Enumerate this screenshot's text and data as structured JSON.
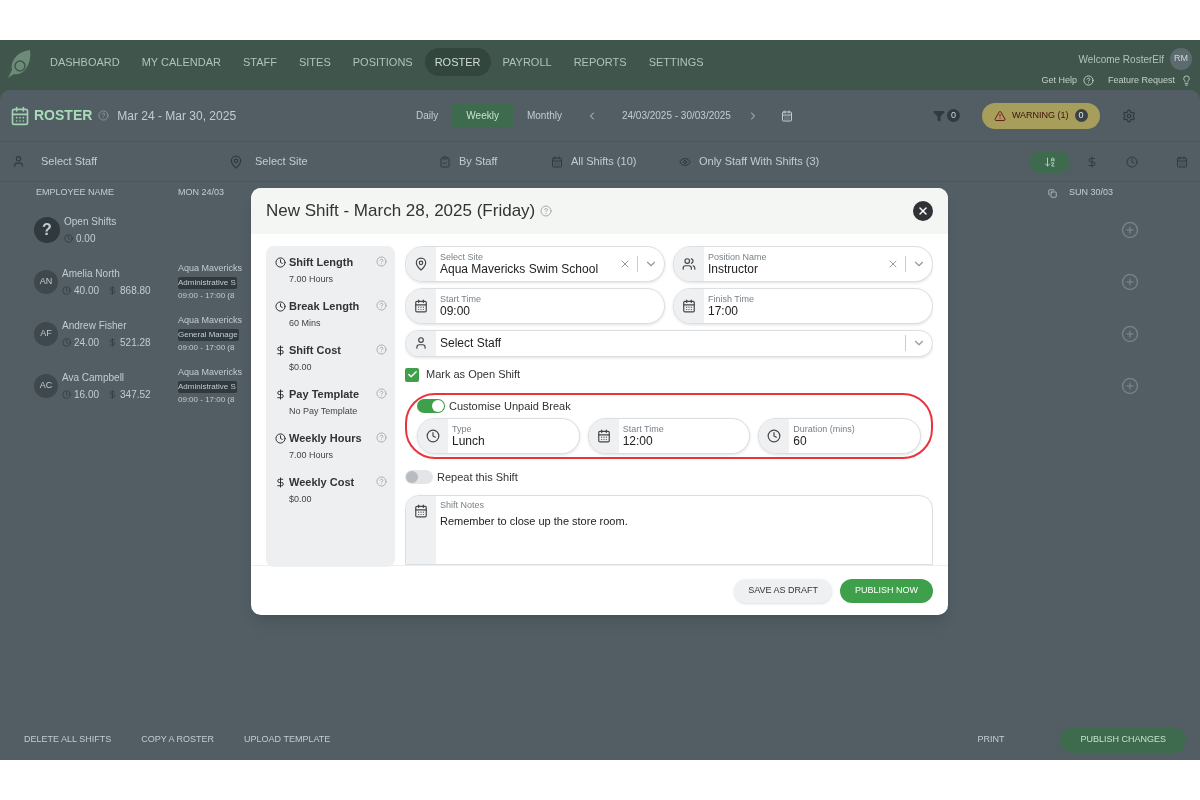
{
  "nav": {
    "items": [
      {
        "label": "DASHBOARD",
        "selected": false
      },
      {
        "label": "MY CALENDAR",
        "selected": false
      },
      {
        "label": "STAFF",
        "selected": false
      },
      {
        "label": "SITES",
        "selected": false
      },
      {
        "label": "POSITIONS",
        "selected": false
      },
      {
        "label": "ROSTER",
        "selected": true
      },
      {
        "label": "PAYROLL",
        "selected": false
      },
      {
        "label": "REPORTS",
        "selected": false
      },
      {
        "label": "SETTINGS",
        "selected": false
      }
    ],
    "welcome": "Welcome RosterElf",
    "avatar": "RM",
    "help": "Get Help",
    "feature": "Feature Request"
  },
  "toolbar": {
    "title": "ROSTER",
    "range": "Mar 24 - Mar 30, 2025",
    "views": [
      {
        "label": "Daily",
        "selected": false
      },
      {
        "label": "Weekly",
        "selected": true
      },
      {
        "label": "Monthly",
        "selected": false
      }
    ],
    "dates": "24/03/2025 - 30/03/2025",
    "filter_count": "0",
    "warning": "WARNING (1)",
    "warning_count": "0"
  },
  "filters": {
    "staff_placeholder": "Select Staff",
    "site_placeholder": "Select Site",
    "group": "By Staff",
    "shifts": "All Shifts (10)",
    "show": "Only Staff With Shifts (3)"
  },
  "roster": {
    "columns": [
      "EMPLOYEE NAME",
      "MON 24/03",
      "SUN 30/03"
    ],
    "rows": [
      {
        "kind": "open",
        "mark": "?",
        "name": "Open Shifts",
        "hours": "0.00"
      },
      {
        "kind": "staff",
        "initials": "AN",
        "name": "Amelia North",
        "hours": "40.00",
        "cost": "868.80",
        "shift": {
          "site": "Aqua Mavericks",
          "position": "Administrative S",
          "time": "09:00 - 17:00 (8"
        }
      },
      {
        "kind": "staff",
        "initials": "AF",
        "name": "Andrew Fisher",
        "hours": "24.00",
        "cost": "521.28",
        "shift": {
          "site": "Aqua Mavericks",
          "position": "General Manage",
          "time": "09:00 - 17:00 (8"
        }
      },
      {
        "kind": "staff",
        "initials": "AC",
        "name": "Ava Campbell",
        "hours": "16.00",
        "cost": "347.52",
        "shift": {
          "site": "Aqua Mavericks",
          "position": "Administrative S",
          "time": "09:00 - 17:00 (8"
        }
      }
    ]
  },
  "footer": {
    "left": [
      "DELETE ALL SHIFTS",
      "COPY A ROSTER",
      "UPLOAD TEMPLATE"
    ],
    "print": "PRINT",
    "publish": "PUBLISH CHANGES"
  },
  "dialog": {
    "title": "New Shift - March 28, 2025 (Friday)",
    "stats": [
      {
        "kind": "clock",
        "label": "Shift Length",
        "value": "7.00 Hours"
      },
      {
        "kind": "clock",
        "label": "Break Length",
        "value": "60 Mins"
      },
      {
        "kind": "money",
        "label": "Shift Cost",
        "value": "$0.00"
      },
      {
        "kind": "money",
        "label": "Pay Template",
        "value": "No Pay Template"
      },
      {
        "kind": "clock",
        "label": "Weekly Hours",
        "value": "7.00 Hours"
      },
      {
        "kind": "money",
        "label": "Weekly Cost",
        "value": "$0.00"
      }
    ],
    "site": {
      "label": "Select Site",
      "value": "Aqua Mavericks Swim School"
    },
    "position": {
      "label": "Position Name",
      "value": "Instructor"
    },
    "start": {
      "label": "Start Time",
      "value": "09:00"
    },
    "finish": {
      "label": "Finish Time",
      "value": "17:00"
    },
    "staff": {
      "placeholder": "Select Staff"
    },
    "open_shift": {
      "label": "Mark as Open Shift",
      "checked": true
    },
    "break_toggle": {
      "label": "Customise Unpaid Break",
      "on": true
    },
    "break_fields": [
      {
        "kind": "clock",
        "label": "Type",
        "value": "Lunch"
      },
      {
        "kind": "calendar",
        "label": "Start Time",
        "value": "12:00"
      },
      {
        "kind": "clock",
        "label": "Duration (mins)",
        "value": "60"
      }
    ],
    "repeat": {
      "label": "Repeat this Shift",
      "on": false
    },
    "notes": {
      "label": "Shift Notes",
      "value": "Remember to close up the store room."
    },
    "buttons": {
      "draft": "SAVE AS DRAFT",
      "publish": "PUBLISH NOW"
    }
  }
}
